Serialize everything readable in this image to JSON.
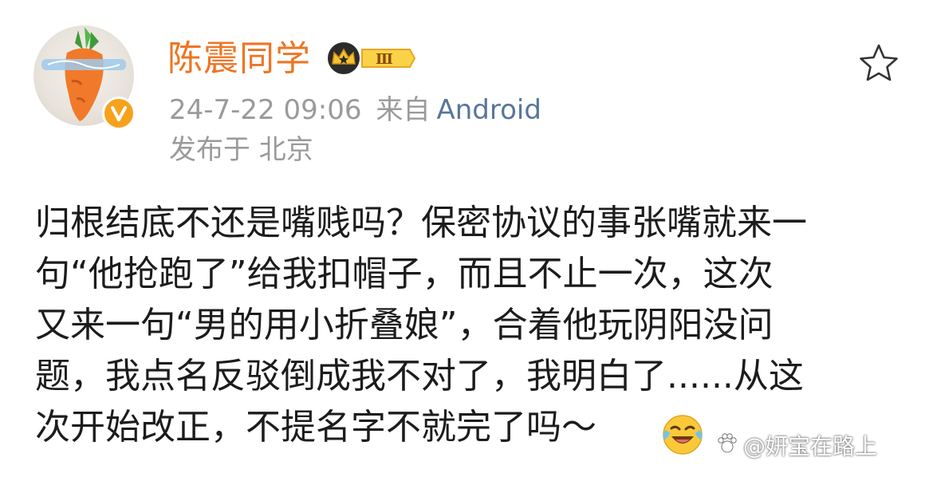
{
  "post": {
    "username": "陈震同学",
    "level_badge": "Ⅲ",
    "date": "24-7-22 09:06",
    "source_prefix": "来自",
    "source": "Android",
    "location": "发布于 北京",
    "body_lines": [
      "归根结底不还是嘴贱吗？保密协议的事张嘴就来一",
      "句“他抢跑了”给我扣帽子，而且不止一次，这次",
      "又来一句“男的用小折叠娘”，合着他玩阴阳没问",
      "题，我点名反驳倒成我不对了，我明白了......从这",
      "次开始改正，不提名字不就完了吗～"
    ]
  },
  "watermark": "@妍宝在路上",
  "colors": {
    "username": "#ef7523",
    "meta": "#9a9a9a",
    "source_link": "#58769a",
    "verified_badge": "#f7a21b",
    "body_text": "#1c1c1c"
  },
  "icons": {
    "verified": "verified-v-icon",
    "level": "crown-level-icon",
    "favorite": "star-outline-icon",
    "emoji": "laugh-cry-emoji"
  }
}
